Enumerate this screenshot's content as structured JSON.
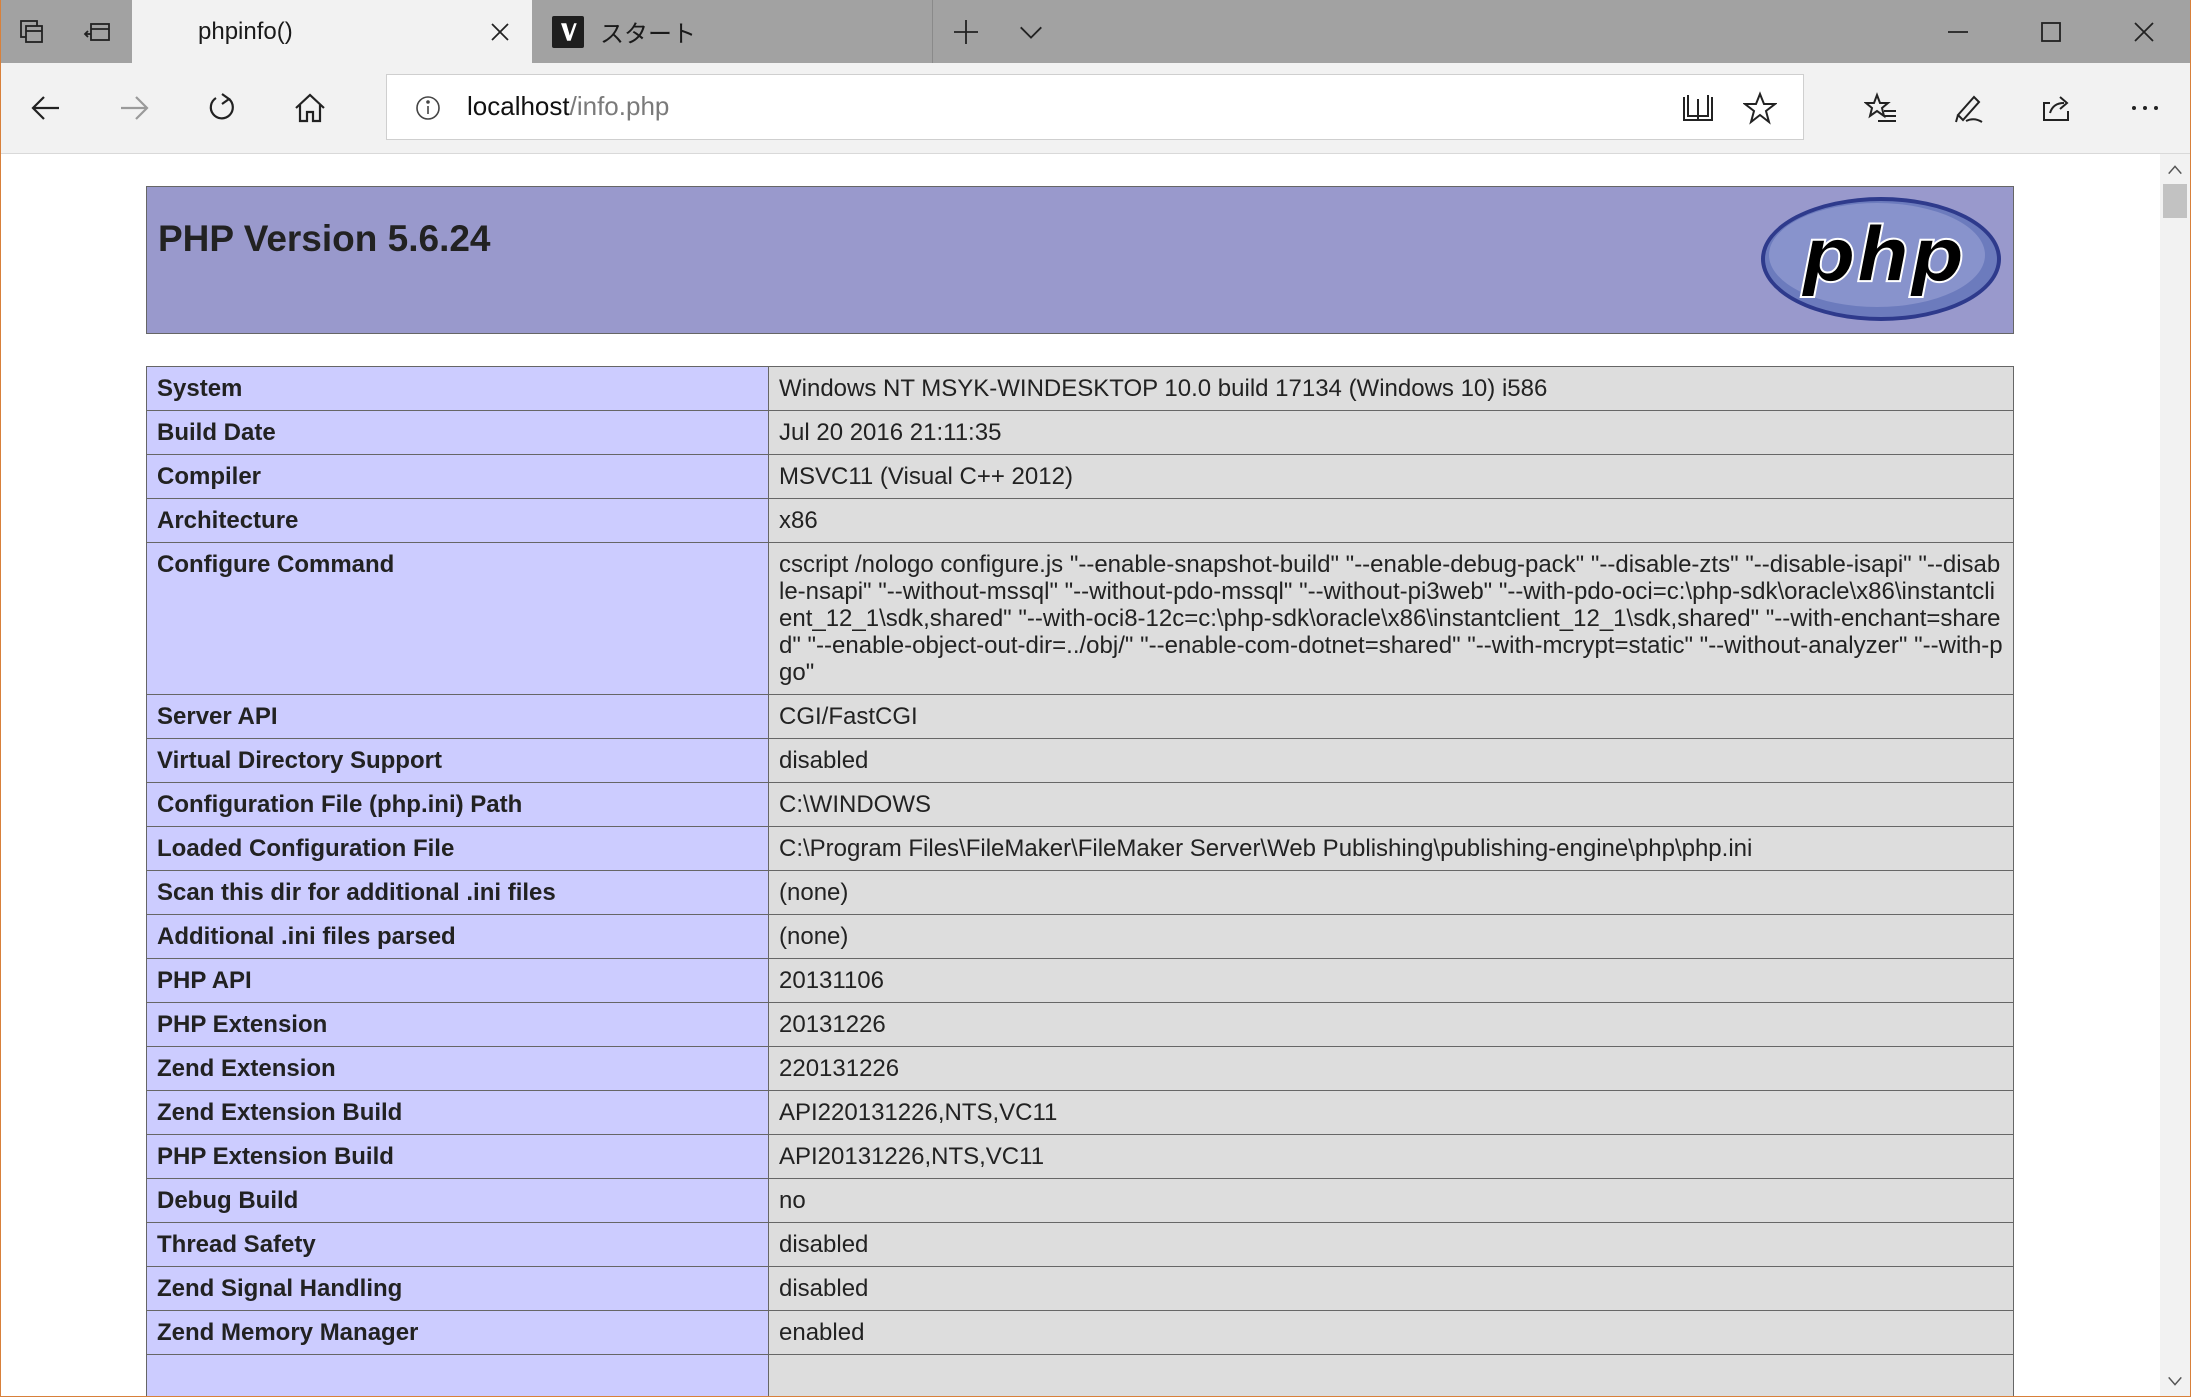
{
  "browser": {
    "tabs": [
      {
        "title": "phpinfo()",
        "active": true
      },
      {
        "title": "スタート",
        "active": false
      }
    ],
    "address": {
      "host": "localhost",
      "path": "/info.php"
    },
    "icons": {
      "tab_actions": [
        "tabs-aside-icon",
        "restore-tabs-icon"
      ],
      "nav": [
        "back-icon",
        "forward-icon",
        "refresh-icon",
        "home-icon"
      ],
      "address": [
        "info-icon",
        "reading-view-icon",
        "favorite-star-icon"
      ],
      "toolbar": [
        "favorites-hub-icon",
        "web-note-icon",
        "share-icon",
        "more-icon"
      ],
      "window": [
        "minimize-icon",
        "maximize-icon",
        "close-icon"
      ]
    }
  },
  "page": {
    "title": "PHP Version 5.6.24",
    "logo_text": "php",
    "rows": [
      {
        "key": "System",
        "value": "Windows NT MSYK-WINDESKTOP 10.0 build 17134 (Windows 10) i586"
      },
      {
        "key": "Build Date",
        "value": "Jul 20 2016 21:11:35"
      },
      {
        "key": "Compiler",
        "value": "MSVC11 (Visual C++ 2012)"
      },
      {
        "key": "Architecture",
        "value": "x86"
      },
      {
        "key": "Configure Command",
        "value": "cscript /nologo configure.js \"--enable-snapshot-build\" \"--enable-debug-pack\" \"--disable-zts\" \"--disable-isapi\" \"--disable-nsapi\" \"--without-mssql\" \"--without-pdo-mssql\" \"--without-pi3web\" \"--with-pdo-oci=c:\\php-sdk\\oracle\\x86\\instantclient_12_1\\sdk,shared\" \"--with-oci8-12c=c:\\php-sdk\\oracle\\x86\\instantclient_12_1\\sdk,shared\" \"--with-enchant=shared\" \"--enable-object-out-dir=../obj/\" \"--enable-com-dotnet=shared\" \"--with-mcrypt=static\" \"--without-analyzer\" \"--with-pgo\""
      },
      {
        "key": "Server API",
        "value": "CGI/FastCGI"
      },
      {
        "key": "Virtual Directory Support",
        "value": "disabled"
      },
      {
        "key": "Configuration File (php.ini) Path",
        "value": "C:\\WINDOWS"
      },
      {
        "key": "Loaded Configuration File",
        "value": "C:\\Program Files\\FileMaker\\FileMaker Server\\Web Publishing\\publishing-engine\\php\\php.ini"
      },
      {
        "key": "Scan this dir for additional .ini files",
        "value": "(none)"
      },
      {
        "key": "Additional .ini files parsed",
        "value": "(none)"
      },
      {
        "key": "PHP API",
        "value": "20131106"
      },
      {
        "key": "PHP Extension",
        "value": "20131226"
      },
      {
        "key": "Zend Extension",
        "value": "220131226"
      },
      {
        "key": "Zend Extension Build",
        "value": "API220131226,NTS,VC11"
      },
      {
        "key": "PHP Extension Build",
        "value": "API20131226,NTS,VC11"
      },
      {
        "key": "Debug Build",
        "value": "no"
      },
      {
        "key": "Thread Safety",
        "value": "disabled"
      },
      {
        "key": "Zend Signal Handling",
        "value": "disabled"
      },
      {
        "key": "Zend Memory Manager",
        "value": "enabled"
      }
    ]
  }
}
